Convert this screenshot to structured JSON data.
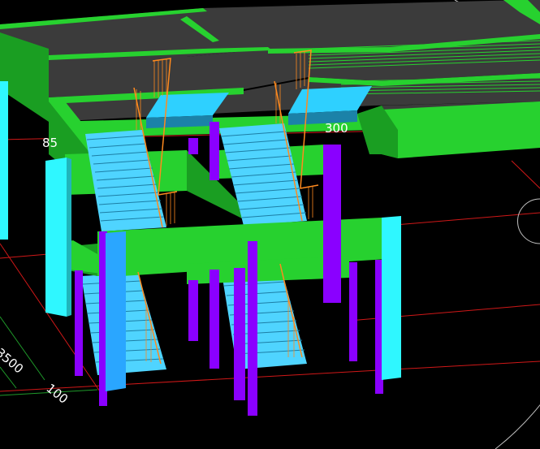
{
  "viewport": {
    "background": "#000000",
    "grid_red": "#d01818",
    "grid_green": "#1f9a2a",
    "orbit_circle": "#bfbfbf"
  },
  "colors": {
    "slab_top": "#3b3b3b",
    "beam_green": "#27d12f",
    "beam_green_dark": "#1a9e22",
    "column_cyan": "#2ff7ff",
    "column_blue": "#2aa6ff",
    "column_purple": "#8a00ff",
    "stair_cyan": "#4fd4ff",
    "stair_edge": "#1c7ea5",
    "landing_top": "#2ed0ff",
    "landing_side": "#1b82a8",
    "railing_orange": "#ff8a1e"
  },
  "dimensions": {
    "label_85": "85",
    "label_300": "300",
    "label_3500": "3500",
    "label_100": "100"
  }
}
